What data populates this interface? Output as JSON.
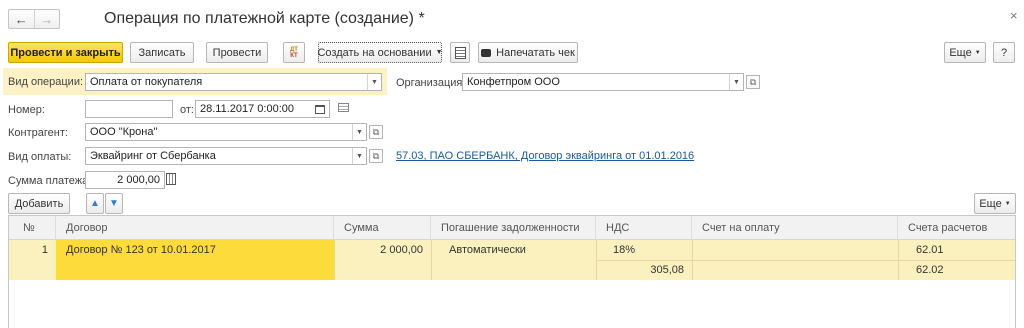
{
  "window": {
    "title": "Операция по платежной карте (создание) *"
  },
  "toolbar": {
    "post_close": "Провести и закрыть",
    "write": "Записать",
    "post": "Провести",
    "dt_kt": "ДТ КТ",
    "create_based": "Создать на основании",
    "print_check": "Напечатать чек",
    "more": "Еще",
    "help": "?"
  },
  "form": {
    "operation_label": "Вид операции:",
    "operation_value": "Оплата от покупателя",
    "org_label": "Организация:",
    "org_value": "Конфетпром ООО",
    "number_label": "Номер:",
    "number_value": "",
    "from_label": "от:",
    "date_value": "28.11.2017  0:00:00",
    "counterparty_label": "Контрагент:",
    "counterparty_value": "ООО \"Крона\"",
    "payment_label": "Вид оплаты:",
    "payment_value": "Эквайринг от Сбербанка",
    "payment_link": "57.03, ПАО СБЕРБАНК, Договор эквайринга от 01.01.2016",
    "amount_label": "Сумма платежа:",
    "amount_value": "2 000,00"
  },
  "table_toolbar": {
    "add": "Добавить",
    "more": "Еще"
  },
  "table": {
    "columns": [
      "№",
      "Договор",
      "Сумма",
      "Погашение задолженности",
      "НДС",
      "Счет на оплату",
      "Счета расчетов"
    ],
    "rows": [
      {
        "num": "1",
        "contract": "Договор № 123 от 10.01.2017",
        "amount": "2 000,00",
        "repayment": "Автоматически",
        "vat_rate": "18%",
        "vat_amount": "305,08",
        "invoice": "",
        "account1": "62.01",
        "account2": "62.02"
      }
    ]
  },
  "colors": {
    "accent": "#f5c900",
    "highlight_row": "#fbf1bf",
    "current_cell": "#fcdb3a",
    "link": "#1c5a9a"
  }
}
